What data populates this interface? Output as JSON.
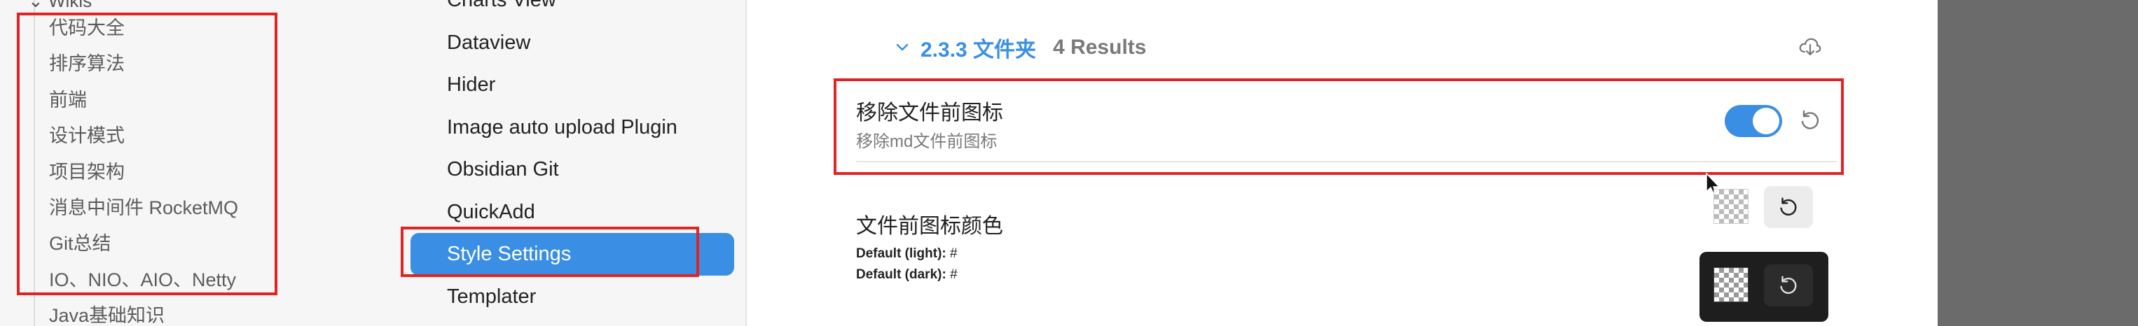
{
  "explorer": {
    "top_folder": "Wikis",
    "files": [
      "代码大全",
      "排序算法",
      "前端",
      "设计模式",
      "项目架构",
      "消息中间件 RocketMQ",
      "Git总结",
      "IO、NIO、AIO、Netty",
      "Java基础知识"
    ]
  },
  "plugins": {
    "items": [
      "Charts View",
      "Dataview",
      "Hider",
      "Image auto upload Plugin",
      "Obsidian Git",
      "QuickAdd",
      "Style Settings",
      "Templater"
    ],
    "active": "Style Settings"
  },
  "section": {
    "title": "2.3.3 文件夹",
    "count": "4 Results"
  },
  "setting_remove_icon": {
    "name": "移除文件前图标",
    "description": "移除md文件前图标",
    "enabled": true
  },
  "setting_icon_color": {
    "name": "文件前图标颜色",
    "default_light_label": "Default (light):",
    "default_light_value": "#",
    "default_dark_label": "Default (dark):",
    "default_dark_value": "#"
  },
  "colors": {
    "accent": "#3a8fe4",
    "highlight_box": "#e02424"
  }
}
